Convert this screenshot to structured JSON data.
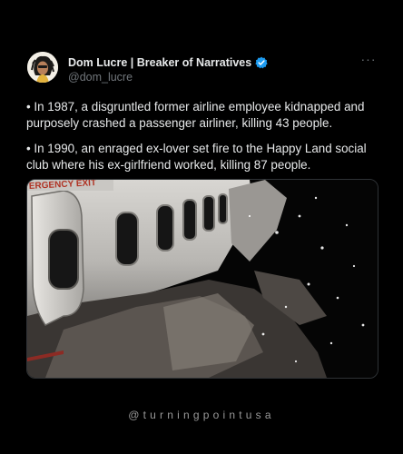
{
  "author": {
    "display_name": "Dom Lucre | Breaker of Narratives",
    "handle": "@dom_lucre",
    "verified": true
  },
  "tweet": {
    "paragraphs": [
      "• In 1987, a disgruntled former airline employee kidnapped and purposely crashed a passenger airliner, killing 43 people.",
      "• In 1990, an enraged ex-lover set fire to the Happy Land social club where his ex-girlfriend worked, killing 87 people."
    ],
    "more_icon": "ellipsis-icon"
  },
  "media": {
    "sign_text": "ERGENCY EXIT"
  },
  "watermark": {
    "text": "@turningpointusa"
  },
  "colors": {
    "background": "#000000",
    "text": "#e7e9ea",
    "secondary": "#71767b",
    "verified": "#1d9bf0"
  }
}
